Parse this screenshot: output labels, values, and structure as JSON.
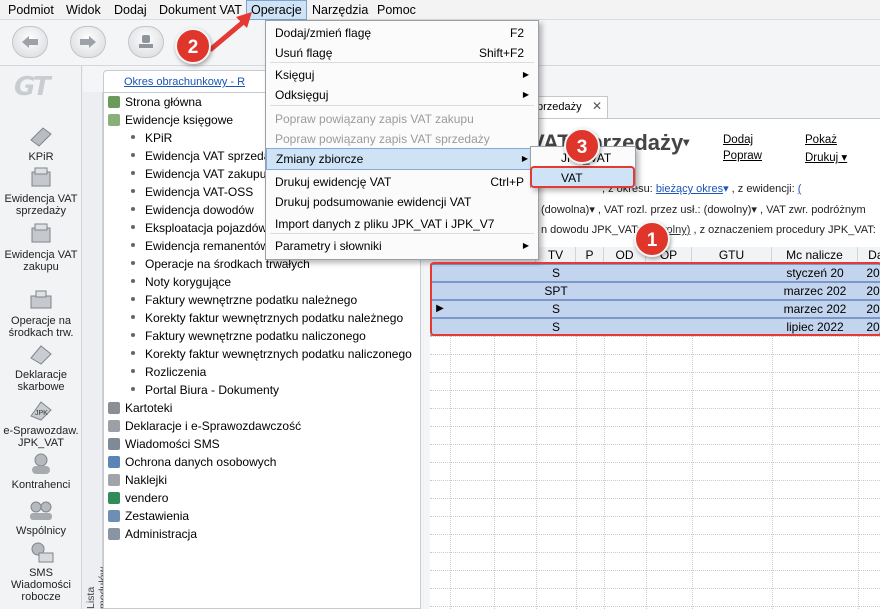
{
  "menubar": {
    "items": [
      "Podmiot",
      "Widok",
      "Dodaj",
      "Dokument VAT",
      "Operacje",
      "Narzędzia",
      "Pomoc"
    ]
  },
  "leftbar": {
    "logo": "GT",
    "items": [
      {
        "label": "KPiR",
        "icon": "kpir-icon"
      },
      {
        "label": "Ewidencja VAT sprzedaży",
        "icon": "vat-sales-icon"
      },
      {
        "label": "Ewidencja VAT zakupu",
        "icon": "vat-purchase-icon"
      },
      {
        "label": "Operacje na środkach trw.",
        "icon": "fixed-assets-icon"
      },
      {
        "label": "Deklaracje skarbowe",
        "icon": "tax-declaration-icon"
      },
      {
        "label": "e-Sprawozdaw. JPK_VAT",
        "icon": "jpk-icon"
      },
      {
        "label": "Kontrahenci",
        "icon": "contractors-icon"
      },
      {
        "label": "Wspólnicy",
        "icon": "partners-icon"
      },
      {
        "label": "SMS Wiadomości robocze",
        "icon": "sms-icon"
      }
    ]
  },
  "navpanel": {
    "period_link": "Okres obrachunkowy - R",
    "vertical_label": "Lista modułów",
    "tree": [
      {
        "label": "Strona główna",
        "level": 0,
        "icon": "home-icon"
      },
      {
        "label": "Ewidencje księgowe",
        "level": 0,
        "icon": "books-icon"
      },
      {
        "label": "KPiR",
        "level": 1
      },
      {
        "label": "Ewidencja VAT sprzedaży",
        "level": 1
      },
      {
        "label": "Ewidencja VAT zakupu",
        "level": 1
      },
      {
        "label": "Ewidencja VAT-OSS",
        "level": 1
      },
      {
        "label": "Ewidencja dowodów",
        "level": 1
      },
      {
        "label": "Eksploatacja pojazdów",
        "level": 1
      },
      {
        "label": "Ewidencja remanentów",
        "level": 1
      },
      {
        "label": "Operacje na środkach trwałych",
        "level": 1
      },
      {
        "label": "Noty korygujące",
        "level": 1
      },
      {
        "label": "Faktury wewnętrzne podatku należnego",
        "level": 1
      },
      {
        "label": "Korekty faktur wewnętrznych podatku należnego",
        "level": 1
      },
      {
        "label": "Faktury wewnętrzne podatku naliczonego",
        "level": 1
      },
      {
        "label": "Korekty faktur wewnętrznych podatku naliczonego",
        "level": 1
      },
      {
        "label": "Rozliczenia",
        "level": 1
      },
      {
        "label": "Portal Biura - Dokumenty",
        "level": 1
      },
      {
        "label": "Kartoteki",
        "level": 0,
        "icon": "cards-icon",
        "expander": true
      },
      {
        "label": "Deklaracje i e-Sprawozdawczość",
        "level": 0,
        "icon": "declarations-icon",
        "expander": true
      },
      {
        "label": "Wiadomości SMS",
        "level": 0,
        "icon": "sms-small-icon",
        "expander": true
      },
      {
        "label": "Ochrona danych osobowych",
        "level": 0,
        "icon": "shield-icon",
        "expander": true
      },
      {
        "label": "Naklejki",
        "level": 0,
        "icon": "sticker-icon",
        "expander": true
      },
      {
        "label": "vendero",
        "level": 0,
        "icon": "vendero-icon",
        "expander": true
      },
      {
        "label": "Zestawienia",
        "level": 0,
        "icon": "reports-icon",
        "expander": true
      },
      {
        "label": "Administracja",
        "level": 0,
        "icon": "admin-icon",
        "expander": true
      }
    ]
  },
  "main": {
    "tab_label": "przedaży",
    "title_partial": "VAT sprzedaży",
    "actions": {
      "add": "Dodaj",
      "fix": "Popraw",
      "show": "Pokaż",
      "print": "Drukuj"
    },
    "filter1": {
      "period_label": ", z okresu:",
      "period_value": "bieżący okres",
      "evid_label": ", z ewidencji:"
    },
    "filter2": {
      "any1": "(dowolna)",
      "rozl_label": ", VAT rozl. przez usł.:",
      "any2": "(dowolny)",
      "zwr_label": ", VAT zwr. podróżnym"
    },
    "filter3": {
      "doc_label": "n dowodu JPK_VAT:",
      "any3": "(dowolny)",
      "proc_label": ", z oznaczeniem procedury JPK_VAT:"
    },
    "grid": {
      "columns": [
        "TV",
        "P",
        "OD",
        "OP",
        "GTU",
        "Mc nalicze",
        "Dat"
      ],
      "rows": [
        {
          "tv": "S",
          "mc": "styczeń 20",
          "dat": "20"
        },
        {
          "tv": "SPT",
          "mc": "marzec 202",
          "dat": "20"
        },
        {
          "tv": "S",
          "mc": "marzec 202",
          "dat": "20"
        },
        {
          "tv": "S",
          "mc": "lipiec 2022",
          "dat": "20"
        }
      ]
    }
  },
  "menu": {
    "items": [
      {
        "label": "Dodaj/zmień flagę",
        "shortcut": "F2"
      },
      {
        "label": "Usuń flagę",
        "shortcut": "Shift+F2"
      },
      {
        "label": "Księguj",
        "submenu": true
      },
      {
        "label": "Odksięguj",
        "submenu": true
      },
      {
        "label": "Popraw powiązany zapis VAT zakupu",
        "disabled": true
      },
      {
        "label": "Popraw powiązany zapis VAT sprzedaży",
        "disabled": true
      },
      {
        "label": "Zmiany zbiorcze",
        "submenu": true,
        "highlighted": true
      },
      {
        "label": "Drukuj ewidencję VAT",
        "shortcut": "Ctrl+P"
      },
      {
        "label": "Drukuj podsumowanie ewidencji VAT"
      },
      {
        "label": "Import danych z pliku JPK_VAT i JPK_V7"
      },
      {
        "label": "Parametry i słowniki",
        "submenu": true
      }
    ]
  },
  "submenu": {
    "items": [
      "JPK_VAT",
      "VAT"
    ]
  },
  "annotations": {
    "badge1": "1",
    "badge2": "2",
    "badge3": "3",
    "color": "#e0352b"
  },
  "colors": {
    "selection": "#cfe3f7",
    "row_highlight": "#c3d4ee",
    "link": "#1a55b8"
  }
}
